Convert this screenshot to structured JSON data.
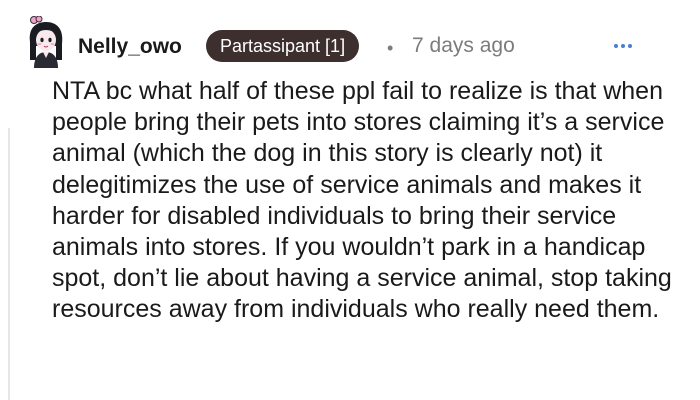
{
  "comment": {
    "username": "Nelly_owo",
    "flair": "Partassipant [1]",
    "separator": "•",
    "timestamp": "7 days ago",
    "body": "NTA bc what half of these ppl fail to realize is that when people bring their pets into stores claiming it’s a service animal (which the dog in this story is clearly not) it delegitimizes the use of service animals and makes it harder for disabled individuals to bring their service animals into stores. If you wouldn’t park in a handicap spot, don’t lie about having a service animal, stop taking resources away from individuals who really need them.",
    "more_icon": "more-horizontal-icon"
  },
  "colors": {
    "flair_bg": "#3d2f2d",
    "meta_text": "#7c7c7c",
    "more_dots": "#4a7fd3",
    "body_text": "#1a1a1b"
  }
}
